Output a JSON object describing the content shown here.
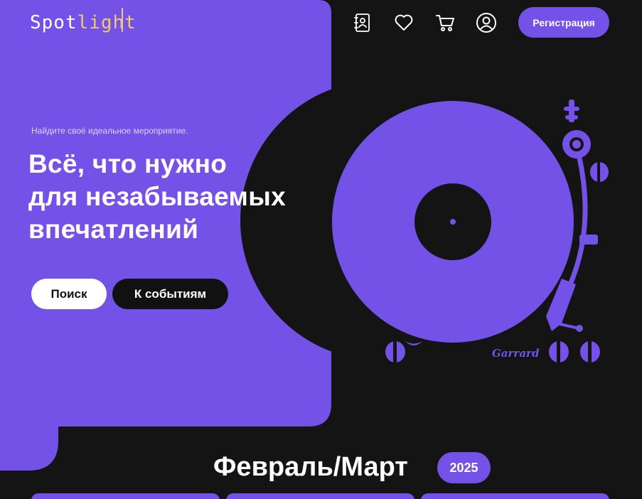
{
  "colors": {
    "accent": "#7452e8",
    "background": "#141414",
    "logo_light": "#ffffff",
    "logo_gold": "#f2c86c"
  },
  "header": {
    "logo_part1": "Spot",
    "logo_part2": "light",
    "icons": [
      "contacts-book-icon",
      "heart-icon",
      "cart-icon",
      "user-icon"
    ],
    "register_label": "Регистрация"
  },
  "hero": {
    "tagline": "Найдите своё идеальное мероприятие.",
    "title_lines": [
      "Всё, что нужно",
      "для незабываемых",
      "впечатлений"
    ],
    "search_label": "Поиск",
    "events_label": "К событиям",
    "turntable_brand": "Garrard"
  },
  "section": {
    "title": "Февраль/Март",
    "year": "2025"
  },
  "cards": [
    {
      "label": ""
    },
    {
      "label": ""
    },
    {
      "label": ""
    }
  ]
}
